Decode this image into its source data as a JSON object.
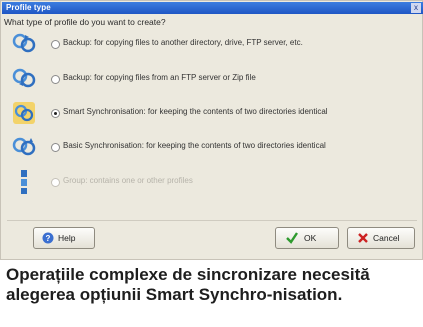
{
  "window": {
    "title": "Profile type",
    "close_glyph": "x"
  },
  "dialog": {
    "question": "What type of profile do you want to create?",
    "options": [
      {
        "label": "Backup: for copying files to another directory, drive, FTP server, etc.",
        "icon": "backup-arrows-icon",
        "selected": false,
        "enabled": true
      },
      {
        "label": "Backup: for copying files from an FTP server or Zip file",
        "icon": "backup-ftp-icon",
        "selected": false,
        "enabled": true
      },
      {
        "label": "Smart Synchronisation: for keeping the contents of two directories identical",
        "icon": "smart-sync-icon",
        "selected": true,
        "enabled": true
      },
      {
        "label": "Basic Synchronisation: for keeping the contents of two directories identical",
        "icon": "basic-sync-icon",
        "selected": false,
        "enabled": true
      },
      {
        "label": "Group: contains one or other profiles",
        "icon": "group-icon",
        "selected": false,
        "enabled": false
      }
    ],
    "buttons": {
      "help": "Help",
      "ok": "OK",
      "cancel": "Cancel"
    }
  },
  "caption": "Operațiile complexe de sincronizare necesită alegerea opțiunii Smart Synchro-nisation.",
  "colors": {
    "titlebar": "#1f56c4",
    "dialog_bg": "#ece9de",
    "ok_check": "#2e9a2e",
    "cancel_x": "#cc2222"
  }
}
